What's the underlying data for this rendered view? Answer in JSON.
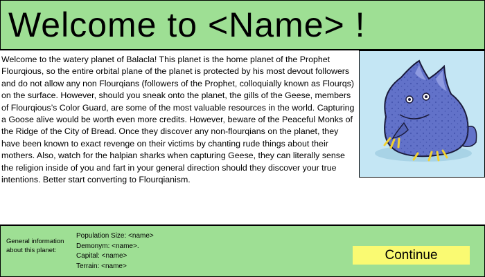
{
  "header": {
    "title": "Welcome to <Name> !"
  },
  "story": {
    "text": "Welcome to the watery planet of Balacla! This planet is the home planet of the Prophet Flourqious, so the entire orbital plane of the planet is protected by his most devout followers and do not allow any non Flourqians (followers of the Prophet, colloquially known as Flourqs) on the surface. However, should you sneak onto the planet, the gills of the Geese, members of Flourqious’s Color Guard, are some of the most valuable resources in the world. Capturing a Goose alive would be worth even more credits. However, beware of the Peaceful Monks of the Ridge of the City of Bread. Once they discover any non-flourqians on the planet, they have been known to exact revenge on their victims by chanting rude things about their mothers. Also, watch for the halpian sharks when capturing Geese, they can literally sense the religion inside of you and fart in your general direction should they discover your true intentions. Better start converting to Flourqianism."
  },
  "portrait": {
    "icon": "blue-goose-creature-icon",
    "background_color": "#c4e6f4",
    "body_color": "#6272c9"
  },
  "planet_info": {
    "label": "General information about this planet:",
    "population": "Population Size: <name>",
    "demonym": "Demonym: <name>.",
    "capital": "Capital: <name>",
    "terrain": "Terrain: <name>"
  },
  "actions": {
    "continue_label": "Continue"
  },
  "colors": {
    "panel_green": "#9edf94",
    "button_yellow": "#fafa72"
  }
}
